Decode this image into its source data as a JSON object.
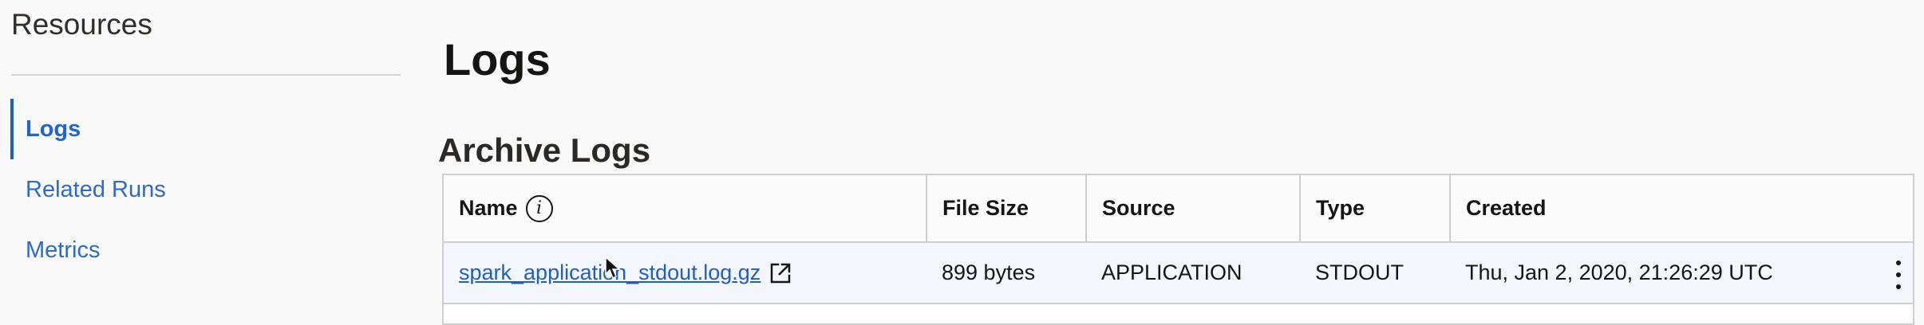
{
  "sidebar": {
    "title": "Resources",
    "items": [
      {
        "label": "Logs",
        "active": true
      },
      {
        "label": "Related Runs",
        "active": false
      },
      {
        "label": "Metrics",
        "active": false
      }
    ]
  },
  "page": {
    "title": "Logs",
    "section_title": "Archive Logs"
  },
  "table": {
    "columns": [
      "Name",
      "File Size",
      "Source",
      "Type",
      "Created"
    ],
    "rows": [
      {
        "name": "spark_application_stdout.log.gz",
        "file_size": "899 bytes",
        "source": "APPLICATION",
        "type": "STDOUT",
        "created": "Thu, Jan 2, 2020, 21:26:29 UTC"
      }
    ]
  },
  "icons": {
    "info": "info-icon",
    "external_link": "external-link-icon",
    "row_actions": "kebab-menu-icon",
    "cursor": "mouse-pointer-icon"
  },
  "colors": {
    "accent": "#1f5fbf",
    "background": "#f9f9f9",
    "row_highlight": "#f3f6fb",
    "border": "#cfcfcf"
  }
}
